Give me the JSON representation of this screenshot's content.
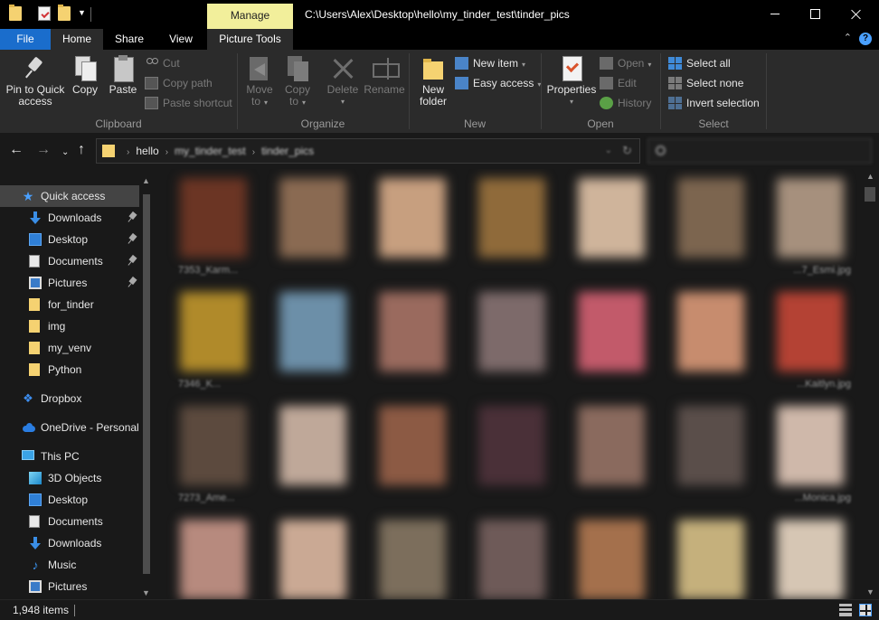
{
  "titlebar": {
    "manage_label": "Manage",
    "path": "C:\\Users\\Alex\\Desktop\\hello\\my_tinder_test\\tinder_pics"
  },
  "tabs": {
    "file": "File",
    "home": "Home",
    "share": "Share",
    "view": "View",
    "picture_tools": "Picture Tools"
  },
  "ribbon": {
    "clipboard": {
      "label": "Clipboard",
      "pin_line1": "Pin to Quick",
      "pin_line2": "access",
      "copy": "Copy",
      "paste": "Paste",
      "cut": "Cut",
      "copy_path": "Copy path",
      "paste_shortcut": "Paste shortcut"
    },
    "organize": {
      "label": "Organize",
      "move_line1": "Move",
      "move_line2": "to",
      "copy_line1": "Copy",
      "copy_line2": "to",
      "delete": "Delete",
      "rename": "Rename"
    },
    "new": {
      "label": "New",
      "folder_line1": "New",
      "folder_line2": "folder",
      "new_item": "New item",
      "easy_access": "Easy access"
    },
    "open": {
      "label": "Open",
      "properties": "Properties",
      "open": "Open",
      "edit": "Edit",
      "history": "History"
    },
    "select": {
      "label": "Select",
      "select_all": "Select all",
      "select_none": "Select none",
      "invert_selection": "Invert selection"
    }
  },
  "address": {
    "crumbs": [
      "hello",
      "my_tinder_test",
      "tinder_pics"
    ]
  },
  "sidebar": {
    "items": [
      {
        "label": "Quick access",
        "icon": "star-icon"
      },
      {
        "label": "Downloads",
        "icon": "download-icon"
      },
      {
        "label": "Desktop",
        "icon": "desktop-icon"
      },
      {
        "label": "Documents",
        "icon": "documents-icon"
      },
      {
        "label": "Pictures",
        "icon": "pictures-icon"
      },
      {
        "label": "for_tinder",
        "icon": "folder-icon"
      },
      {
        "label": "img",
        "icon": "folder-icon"
      },
      {
        "label": "my_venv",
        "icon": "folder-icon"
      },
      {
        "label": "Python",
        "icon": "folder-icon"
      },
      {
        "label": "Dropbox",
        "icon": "dropbox-icon"
      },
      {
        "label": "OneDrive - Personal",
        "icon": "onedrive-icon"
      },
      {
        "label": "This PC",
        "icon": "pc-icon"
      },
      {
        "label": "3D Objects",
        "icon": "3d-objects-icon"
      },
      {
        "label": "Desktop",
        "icon": "desktop-icon"
      },
      {
        "label": "Documents",
        "icon": "documents-icon"
      },
      {
        "label": "Downloads",
        "icon": "download-icon"
      },
      {
        "label": "Music",
        "icon": "music-icon"
      },
      {
        "label": "Pictures",
        "icon": "pictures-icon"
      }
    ]
  },
  "thumbnails": [
    {
      "name": "7353_Karm...",
      "color": "#6b3524"
    },
    {
      "name": "",
      "color": "#8a6a52"
    },
    {
      "name": "",
      "color": "#c79f7f"
    },
    {
      "name": "",
      "color": "#8f6a3a"
    },
    {
      "name": "",
      "color": "#cfb49b"
    },
    {
      "name": "",
      "color": "#7c654f"
    },
    {
      "name": "...7_Esmi.jpg",
      "color": "#a6907d"
    },
    {
      "name": "7346_K...",
      "color": "#b08a2a"
    },
    {
      "name": "",
      "color": "#6c8fa8"
    },
    {
      "name": "",
      "color": "#9a6a5e"
    },
    {
      "name": "",
      "color": "#7d6a6a"
    },
    {
      "name": "",
      "color": "#c25a6a"
    },
    {
      "name": "",
      "color": "#c78c6e"
    },
    {
      "name": "...Kaitlyn.jpg",
      "color": "#b44234"
    },
    {
      "name": "7273_Ame...",
      "color": "#5c4a3e"
    },
    {
      "name": "",
      "color": "#bfa899"
    },
    {
      "name": "",
      "color": "#8c5a44"
    },
    {
      "name": "",
      "color": "#4a3038"
    },
    {
      "name": "",
      "color": "#8a6a5e"
    },
    {
      "name": "",
      "color": "#5a4e4a"
    },
    {
      "name": "...Monica.jpg",
      "color": "#cfb8aa"
    },
    {
      "name": "",
      "color": "#b78a7e"
    },
    {
      "name": "",
      "color": "#caa994"
    },
    {
      "name": "",
      "color": "#7c6e5c"
    },
    {
      "name": "",
      "color": "#6e5a58"
    },
    {
      "name": "",
      "color": "#a4704c"
    },
    {
      "name": "",
      "color": "#c5b07c"
    },
    {
      "name": "",
      "color": "#d6c6b4"
    }
  ],
  "status": {
    "item_count": "1,948 items"
  }
}
